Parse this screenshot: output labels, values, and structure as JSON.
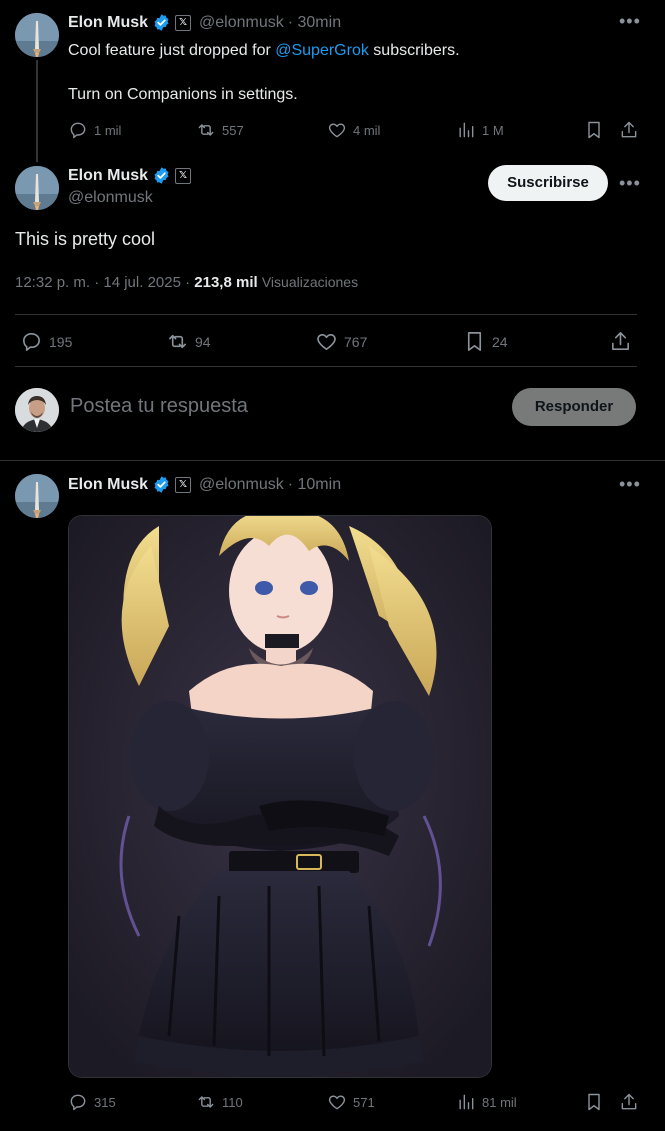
{
  "tweets": {
    "first": {
      "name": "Elon Musk",
      "handle": "@elonmusk",
      "time": "· 30min",
      "line1_pre": "Cool feature just dropped for ",
      "line1_link": "@SuperGrok",
      "line1_post": " subscribers.",
      "line2": "Turn on Companions in settings.",
      "replies": "1 mil",
      "retweets": "557",
      "likes": "4 mil",
      "views": "1 M"
    },
    "main": {
      "name": "Elon Musk",
      "handle": "@elonmusk",
      "subscribe_label": "Suscribirse",
      "text": "This is pretty cool",
      "timestamp": "12:32 p. m. · 14 jul. 2025 ·",
      "views_count": "213,8 mil",
      "views_label": "Visualizaciones",
      "replies": "195",
      "retweets": "94",
      "likes": "767",
      "bookmarks": "24"
    },
    "third": {
      "name": "Elon Musk",
      "handle": "@elonmusk",
      "time": "· 10min",
      "replies": "315",
      "retweets": "110",
      "likes": "571",
      "views": "81 mil"
    }
  },
  "reply_box": {
    "placeholder": "Postea tu respuesta",
    "button_label": "Responder"
  },
  "colors": {
    "background": "#000000",
    "text": "#e7e9ea",
    "muted": "#71767b",
    "link": "#1d9bf0",
    "verified": "#1d9bf0",
    "divider": "#2f3336"
  },
  "icons": {
    "verified": "verified-badge-icon",
    "x_logo": "x-logo-icon",
    "reply": "reply-bubble-icon",
    "retweet": "retweet-icon",
    "like": "heart-icon",
    "views": "bar-chart-icon",
    "bookmark": "bookmark-icon",
    "share": "share-icon",
    "more": "more-dots-icon"
  }
}
